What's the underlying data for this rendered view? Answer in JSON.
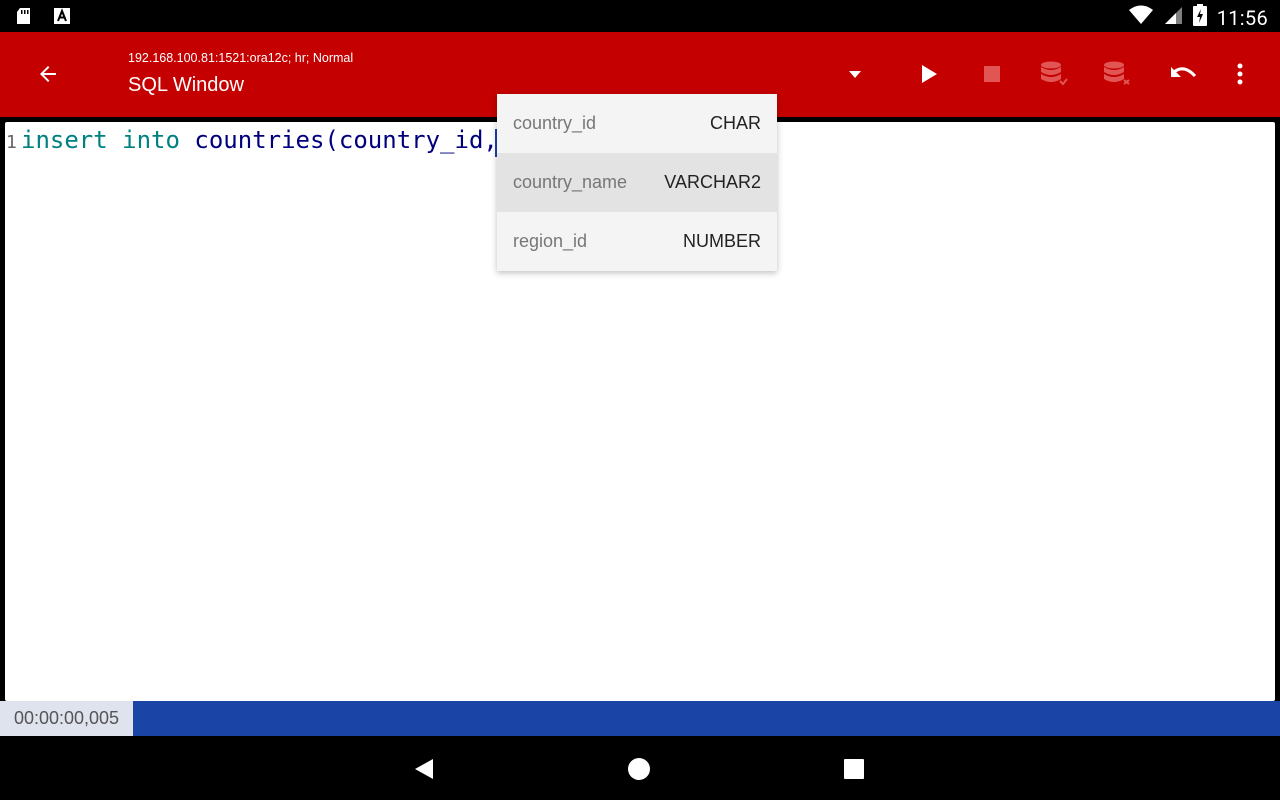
{
  "status_bar": {
    "time": "11:56",
    "icons": [
      "sd-card-icon",
      "app-notification-icon",
      "wifi-icon",
      "signal-icon",
      "battery-charging-icon"
    ]
  },
  "app_bar": {
    "connection": "192.168.100.81:1521:ora12c; hr; Normal",
    "title": "SQL Window",
    "accent_color": "#c40000",
    "actions": [
      "dropdown-icon",
      "run-icon",
      "stop-icon",
      "commit-icon",
      "rollback-icon",
      "undo-icon",
      "more-icon"
    ]
  },
  "editor": {
    "line_number": "1",
    "code": {
      "kw1": "insert",
      "kw2": "into",
      "rest": "countries(country_id,"
    }
  },
  "autocomplete": {
    "items": [
      {
        "name": "country_id",
        "type": "CHAR"
      },
      {
        "name": "country_name",
        "type": "VARCHAR2"
      },
      {
        "name": "region_id",
        "type": "NUMBER"
      }
    ]
  },
  "footer": {
    "elapsed": "00:00:00,005",
    "bar_color": "#1a44a6"
  },
  "nav_bar": {
    "buttons": [
      "back-icon",
      "home-icon",
      "recents-icon"
    ]
  }
}
